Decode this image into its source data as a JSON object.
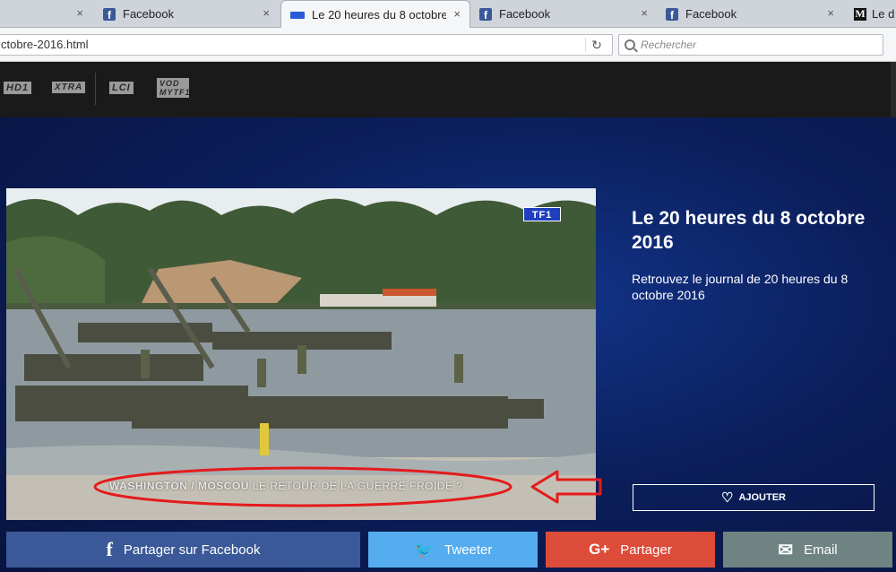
{
  "tabs": [
    {
      "title": "",
      "icon": "none",
      "active": false
    },
    {
      "title": "Facebook",
      "icon": "facebook-icon",
      "active": false
    },
    {
      "title": "Le 20 heures du 8 octobre ...",
      "icon": "tf1-favicon",
      "active": true
    },
    {
      "title": "Facebook",
      "icon": "facebook-icon",
      "active": false
    },
    {
      "title": "Facebook",
      "icon": "facebook-icon",
      "active": false
    },
    {
      "title": "Le d",
      "icon": "le-monde-icon",
      "active": false
    }
  ],
  "close_glyph": "×",
  "address": {
    "url": "ctobre-2016.html",
    "search_placeholder": "Rechercher",
    "refresh_glyph": "↻"
  },
  "channels": [
    "HD1",
    "XTRA",
    "LCI",
    "VOD MYTF1"
  ],
  "video": {
    "channel_logo": "TF1",
    "caption_bold": "WASHINGTON / MOSCOU",
    "caption_rest": "LE RETOUR DE LA GUERRE FROIDE ?"
  },
  "info": {
    "title": "Le 20 heures du 8 octobre 2016",
    "description": "Retrouvez le journal de 20 heures du 8 octobre 2016",
    "add_label": "AJOUTER",
    "add_icon": "heart-outline-icon"
  },
  "share": {
    "facebook": {
      "label": "Partager sur Facebook",
      "icon": "f"
    },
    "twitter": {
      "label": "Tweeter",
      "icon": "🐦"
    },
    "google": {
      "label": "Partager",
      "icon": "G+"
    },
    "email": {
      "label": "Email",
      "icon": "✉"
    }
  },
  "colors": {
    "facebook": "#3b5998",
    "twitter": "#55acee",
    "google": "#dd4b39",
    "email": "#6f8383",
    "annotation": "#e41b1b"
  }
}
